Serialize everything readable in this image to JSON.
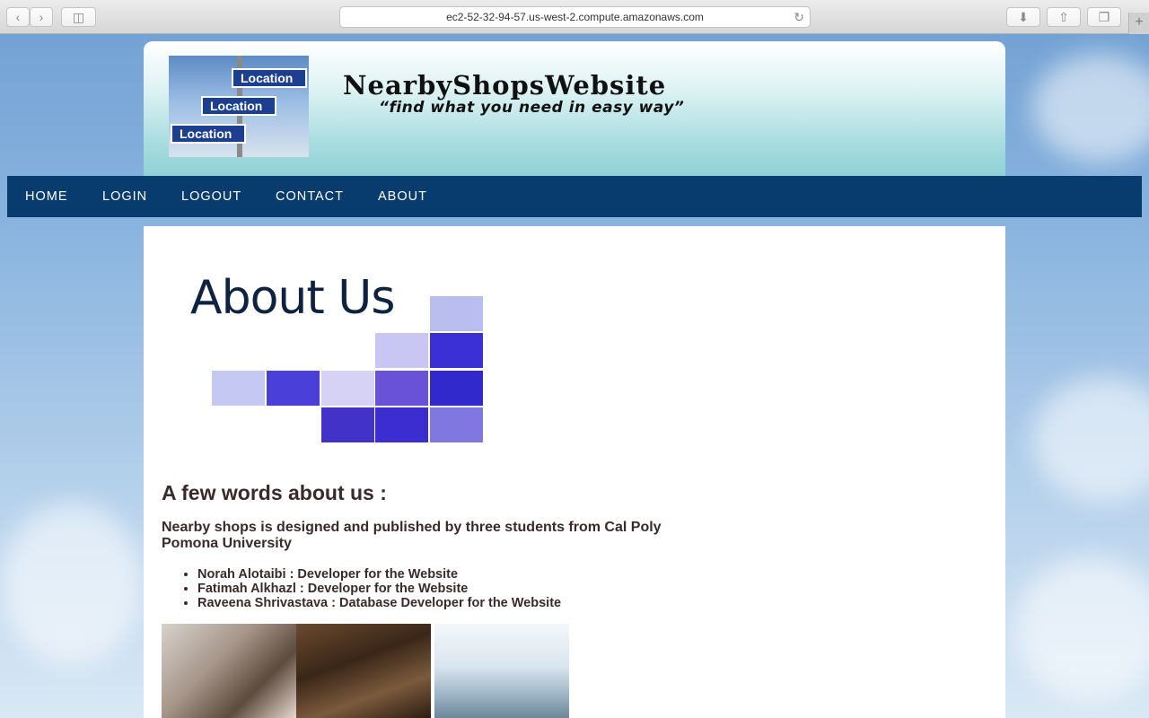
{
  "browser": {
    "url": "ec2-52-32-94-57.us-west-2.compute.amazonaws.com",
    "icons": [
      "back-icon",
      "forward-icon",
      "sidebar-icon",
      "reload-icon",
      "download-icon",
      "share-icon",
      "tabs-icon",
      "new-tab-icon"
    ]
  },
  "header": {
    "logo_signs": [
      "Location",
      "Location",
      "Location"
    ],
    "title": "NearbyShopsWebsite",
    "slogan": "“find what you need in easy way”"
  },
  "nav": {
    "items": [
      "HOME",
      "LOGIN",
      "LOGOUT",
      "CONTACT",
      "ABOUT"
    ]
  },
  "content": {
    "about_image_text": "About Us",
    "heading": "A few words about us :",
    "intro": "Nearby shops is designed and published by three students from Cal Poly Pomona University",
    "members": [
      "Norah Alotaibi : Developer for the Website",
      "Fatimah Alkhazl : Developer for the Website",
      "Raveena Shrivastava : Database Developer for the Website"
    ]
  },
  "colors": {
    "nav_bg": "#093c6e",
    "text": "#3a2a2a",
    "header_teal": "#8fd0d6"
  }
}
